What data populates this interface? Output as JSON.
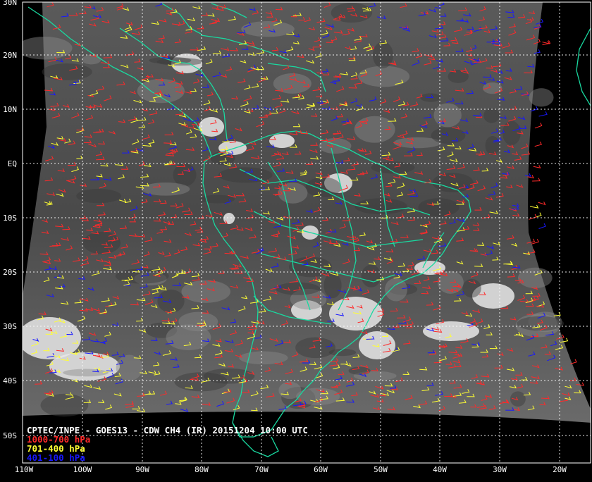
{
  "title": "CPTEC/INPE - GOES13 - CDW CH4 (IR) 20151204 10:00 UTC",
  "legend": [
    {
      "label": "1000-700 hPa",
      "color": "#ff2a2a"
    },
    {
      "label": "701-400 hPa",
      "color": "#ffff33"
    },
    {
      "label": "401-100 hPa",
      "color": "#1818ff"
    }
  ],
  "lat_labels": [
    "30N",
    "20N",
    "10N",
    "EQ",
    "10S",
    "20S",
    "30S",
    "40S",
    "50S"
  ],
  "lon_labels": [
    "110W",
    "100W",
    "90W",
    "80W",
    "70W",
    "60W",
    "50W",
    "40W",
    "30W",
    "20W"
  ],
  "map_colors": {
    "background": "#000000",
    "coastline": "#19d9a0",
    "graticule": "#ffffff"
  }
}
